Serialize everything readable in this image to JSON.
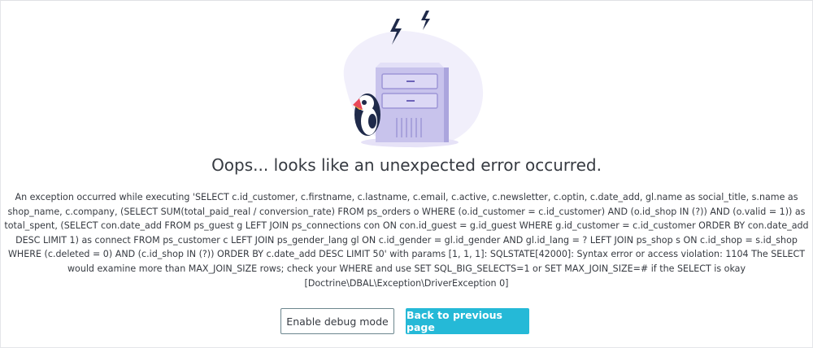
{
  "error": {
    "title": "Oops... looks like an unexpected error occurred.",
    "message": "An exception occurred while executing 'SELECT c.id_customer, c.firstname, c.lastname, c.email, c.active, c.newsletter, c.optin, c.date_add, gl.name as social_title, s.name as shop_name, c.company, (SELECT SUM(total_paid_real / conversion_rate) FROM ps_orders o WHERE (o.id_customer = c.id_customer) AND (o.id_shop IN (?)) AND (o.valid = 1)) as total_spent, (SELECT con.date_add FROM ps_guest g LEFT JOIN ps_connections con ON con.id_guest = g.id_guest WHERE g.id_customer = c.id_customer ORDER BY con.date_add DESC LIMIT 1) as connect FROM ps_customer c LEFT JOIN ps_gender_lang gl ON c.id_gender = gl.id_gender AND gl.id_lang = ? LEFT JOIN ps_shop s ON c.id_shop = s.id_shop WHERE (c.deleted = 0) AND (c.id_shop IN (?)) ORDER BY c.date_add DESC LIMIT 50' with params [1, 1, 1]: SQLSTATE[42000]: Syntax error or access violation: 1104 The SELECT would examine more than MAX_JOIN_SIZE rows; check your WHERE and use SET SQL_BIG_SELECTS=1 or SET MAX_JOIN_SIZE=# if the SELECT is okay",
    "exception_class": "[Doctrine\\DBAL\\Exception\\DriverException 0]"
  },
  "actions": {
    "debug_label": "Enable debug mode",
    "back_label": "Back to previous page"
  },
  "colors": {
    "primary": "#25b9d7",
    "text": "#363a41",
    "server": "#c8c4ee",
    "blob": "#f0eefa"
  }
}
